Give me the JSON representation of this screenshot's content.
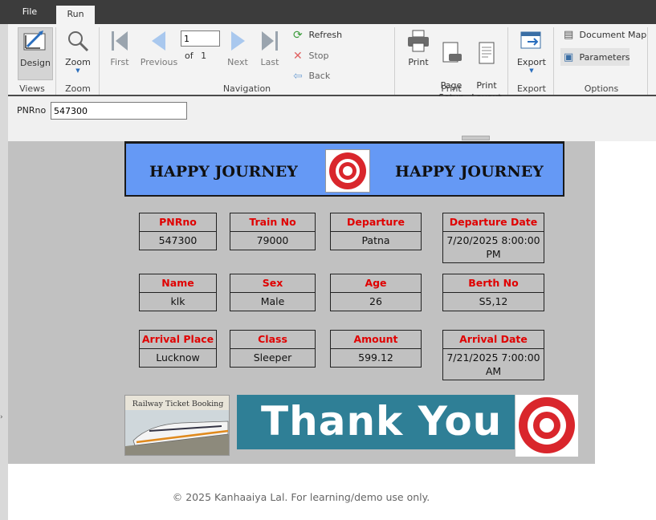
{
  "tabs": {
    "file": "File",
    "run": "Run"
  },
  "ribbon": {
    "views": {
      "design_label": "Design",
      "group_label": "Views"
    },
    "zoom": {
      "zoom_label": "Zoom",
      "group_label": "Zoom"
    },
    "navigation": {
      "first_label": "First",
      "previous_label": "Previous",
      "page_value": "1",
      "of_label": "of",
      "total_pages": "1",
      "next_label": "Next",
      "last_label": "Last",
      "refresh_label": "Refresh",
      "stop_label": "Stop",
      "back_label": "Back",
      "group_label": "Navigation"
    },
    "print": {
      "print_label": "Print",
      "page_setup_label": "Page\nSetup",
      "print_layout_label": "Print\nLayout",
      "group_label": "Print"
    },
    "export": {
      "export_label": "Export",
      "group_label": "Export"
    },
    "options": {
      "document_map_label": "Document Map",
      "parameters_label": "Parameters",
      "group_label": "Options"
    }
  },
  "parameters": {
    "pnr_label": "PNRno",
    "pnr_value": "547300"
  },
  "report": {
    "banner_left": "HAPPY JOURNEY",
    "banner_right": "HAPPY JOURNEY",
    "fields": [
      {
        "header": "PNRno",
        "value": "547300"
      },
      {
        "header": "Train No",
        "value": "79000"
      },
      {
        "header": "Departure Place",
        "value": "Patna"
      },
      {
        "header": "Departure Date",
        "value": "7/20/2025 8:00:00 PM"
      },
      {
        "header": "Name",
        "value": "klk"
      },
      {
        "header": "Sex",
        "value": "Male"
      },
      {
        "header": "Age",
        "value": "26"
      },
      {
        "header": "Berth No",
        "value": "S5,12"
      },
      {
        "header": "Arrival Place",
        "value": "Lucknow"
      },
      {
        "header": "Class",
        "value": "Sleeper"
      },
      {
        "header": "Amount",
        "value": "599.12"
      },
      {
        "header": "Arrival Date",
        "value": "7/21/2025 7:00:00 AM"
      }
    ],
    "rail_image_title": "Railway Ticket Booking",
    "thanks_text": "Thank You"
  },
  "footer": "© 2025 Kanhaaiya Lal. For learning/demo use only.",
  "colors": {
    "banner_blue": "#6599f5",
    "header_red": "#e00000",
    "report_gray": "#c1c1c1",
    "accent_blue": "#5b9bd5"
  }
}
